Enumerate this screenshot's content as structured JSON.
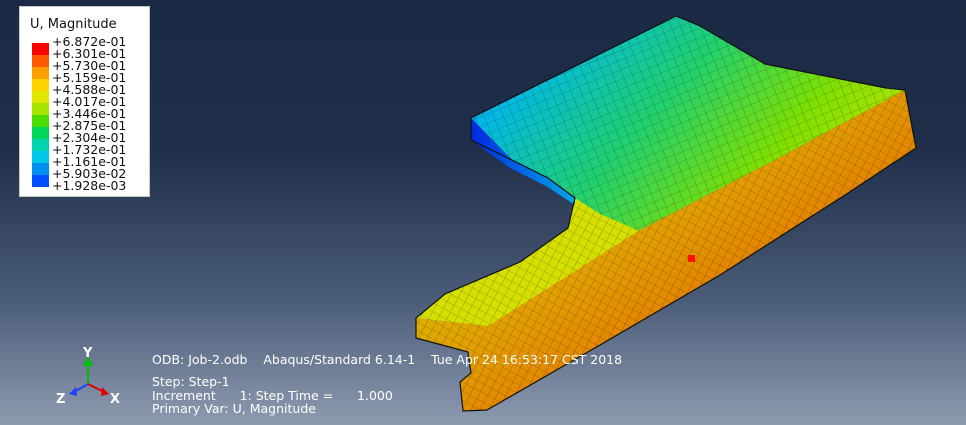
{
  "legend": {
    "title": "U, Magnitude",
    "labels": [
      "+6.872e-01",
      "+6.301e-01",
      "+5.730e-01",
      "+5.159e-01",
      "+4.588e-01",
      "+4.017e-01",
      "+3.446e-01",
      "+2.875e-01",
      "+2.304e-01",
      "+1.732e-01",
      "+1.161e-01",
      "+5.903e-02",
      "+1.928e-03"
    ],
    "colors": [
      "#ff0000",
      "#ff5a00",
      "#ffa000",
      "#ffd200",
      "#dfe800",
      "#a6e600",
      "#4ddd00",
      "#00d85a",
      "#00d4b0",
      "#00c8e8",
      "#0090f0",
      "#0050ff",
      "#0000ff"
    ]
  },
  "info": {
    "line1": "ODB: Job-2.odb    Abaqus/Standard 6.14-1    Tue Apr 24 16:53:17 CST 2018",
    "step": "Step: Step-1",
    "increment": "Increment      1: Step Time =      1.000",
    "primary_var": "Primary Var: U, Magnitude"
  },
  "triad": {
    "x_label": "X",
    "y_label": "Y",
    "z_label": "Z"
  }
}
